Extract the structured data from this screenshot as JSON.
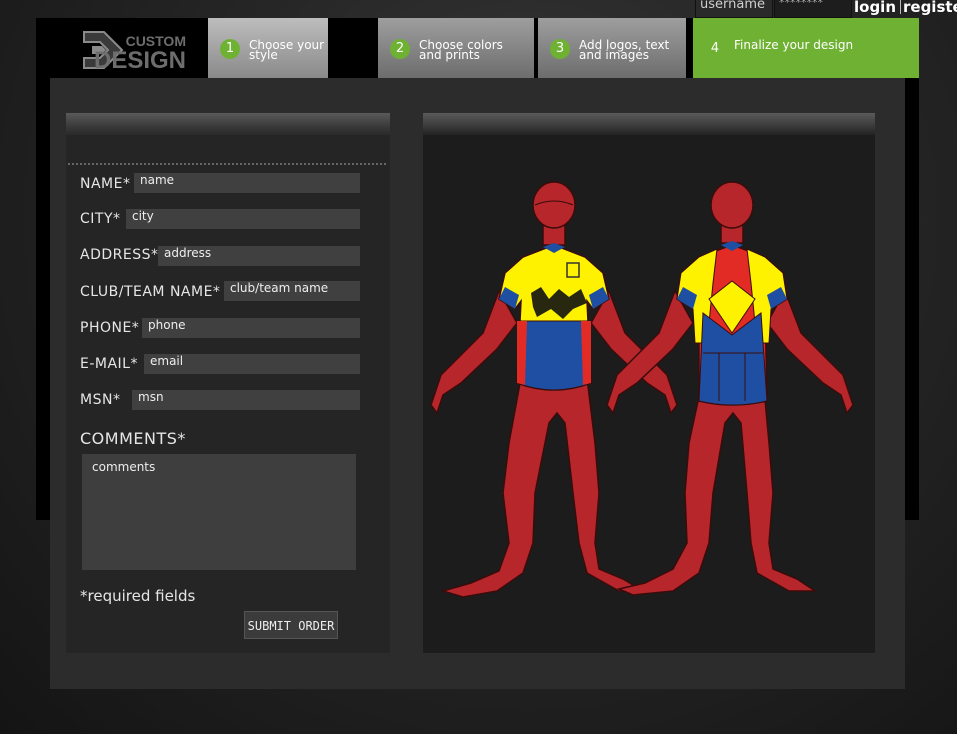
{
  "topbar": {
    "username_placeholder": "username",
    "password_value": "********",
    "login_label": "login",
    "register_label": "register"
  },
  "logo": {
    "line1": "CUSTOM",
    "line2": "DESIGN"
  },
  "steps": [
    {
      "number": "1",
      "label": "Choose your style",
      "state": "completed"
    },
    {
      "number": "2",
      "label": "Choose colors\nand prints",
      "state": "completed"
    },
    {
      "number": "3",
      "label": "Add logos, text\nand images",
      "state": "completed"
    },
    {
      "number": "4",
      "label": "Finalize your design",
      "state": "active"
    }
  ],
  "form": {
    "name_label": "NAME*",
    "name_placeholder": "name",
    "city_label": "CITY*",
    "city_placeholder": "city",
    "address_label": "ADDRESS*",
    "address_placeholder": "address",
    "club_label": "CLUB/TEAM NAME*",
    "club_placeholder": "club/team name",
    "phone_label": "PHONE*",
    "phone_placeholder": "phone",
    "email_label": "E-MAIL*",
    "email_placeholder": "email",
    "msn_label": "MSN*",
    "msn_placeholder": "msn",
    "comments_label": "COMMENTS*",
    "comments_placeholder": "comments",
    "required_note": "*required fields",
    "submit_label": "SUBMIT ORDER"
  },
  "colors": {
    "accent_green": "#6fb233",
    "body_red": "#b6262a",
    "jersey_yellow": "#fff200",
    "jersey_blue": "#1f4fa3",
    "jersey_red": "#e22b25"
  }
}
